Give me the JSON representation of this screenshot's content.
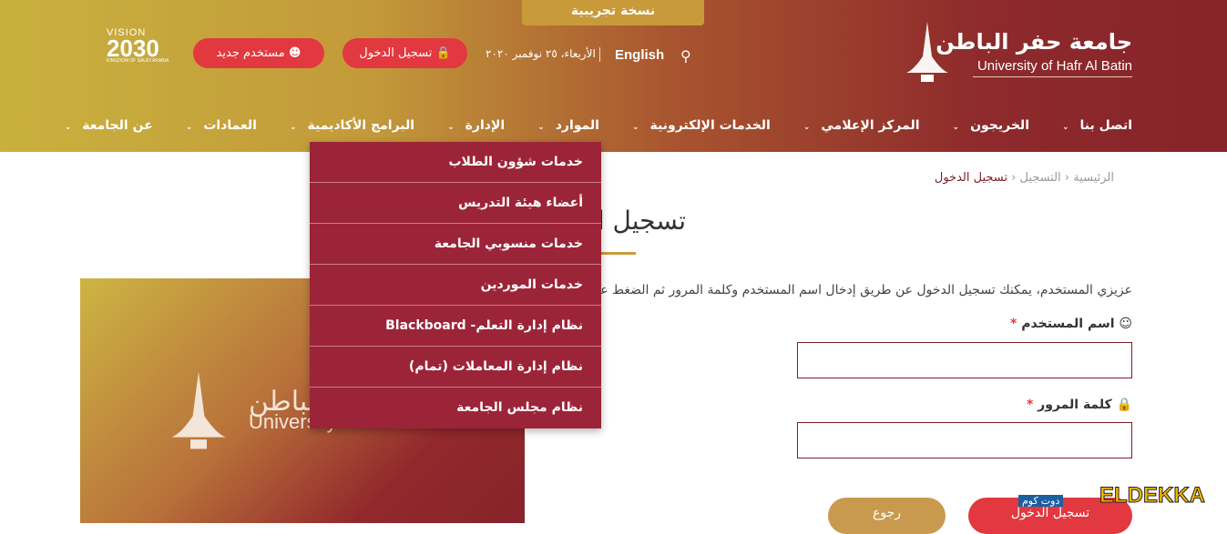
{
  "header": {
    "trial_badge": "نسخة تجريبية",
    "logo": {
      "arabic": "جامعة حفر الباطن",
      "english": "University of Hafr Al Batin"
    },
    "language_link": "English",
    "date": "الأربعاء، ٢٥ نوفمبر ٢٠٢٠",
    "login_button": "تسجيل الدخول",
    "new_user_button": "مستخدم جديد",
    "vision_logo": {
      "top": "VISION رؤية",
      "year": "2030",
      "sub_ar": "المملكة العربية السعودية",
      "sub_en": "KINGDOM OF SAUDI ARABIA"
    },
    "colors": {
      "accent_red": "#e2383f",
      "gold": "#c99a3a",
      "maroon": "#86242a"
    }
  },
  "nav": {
    "items": [
      {
        "label": "عن الجامعة"
      },
      {
        "label": "العمادات"
      },
      {
        "label": "البرامج الأكاديمية"
      },
      {
        "label": "الإدارة"
      },
      {
        "label": "الموارد"
      },
      {
        "label": "الخدمات الإلكترونية"
      },
      {
        "label": "المركز الإعلامي"
      },
      {
        "label": "الخريجون"
      },
      {
        "label": "اتصل بنا"
      }
    ]
  },
  "dropdown": {
    "items": [
      {
        "label": "خدمات شؤون الطلاب"
      },
      {
        "label": "أعضاء هيئة التدريس"
      },
      {
        "label": "خدمات منسوبي الجامعة"
      },
      {
        "label": "خدمات الموردين"
      },
      {
        "label": "نظام إدارة التعلم- Blackboard"
      },
      {
        "label": "نظام إدارة المعاملات (تمام)"
      },
      {
        "label": "نظام مجلس الجامعة"
      }
    ]
  },
  "breadcrumb": {
    "home": "الرئيسية",
    "section": "التسجيل",
    "current": "تسجيل الدخول"
  },
  "main": {
    "title": "تسجيل الدخول",
    "intro": "عزيزي المستخدم، يمكنك تسجيل الدخول عن طريق إدخال اسم المستخدم وكلمة المرور ثم الضغط على زر",
    "username_label": "اسم المستخدم",
    "password_label": "كلمة المرور",
    "required_mark": "*",
    "submit_button": "تسجيل الدخول",
    "back_button": "رجوع"
  },
  "image": {
    "arabic": "جامعة حفر الباطن",
    "english": "University of Hafr Al Batin"
  },
  "watermark": {
    "text": "ELDEKKA",
    "arabic": "دوت كوم"
  }
}
